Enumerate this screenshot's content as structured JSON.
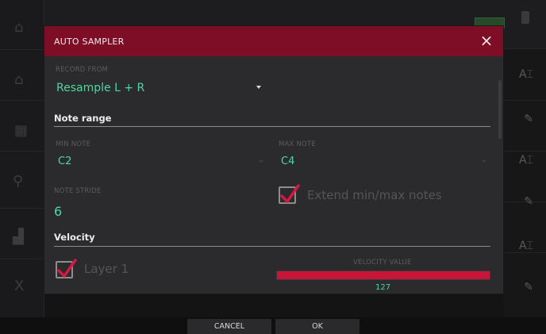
{
  "dialog": {
    "title": "AUTO SAMPLER",
    "record_from": {
      "label": "RECORD FROM",
      "value": "Resample L + R"
    },
    "note_range": {
      "heading": "Note range",
      "min_note": {
        "label": "MIN NOTE",
        "value": "C2"
      },
      "max_note": {
        "label": "MAX NOTE",
        "value": "C4"
      },
      "note_stride": {
        "label": "NOTE STRIDE",
        "value": "6"
      },
      "extend": {
        "label": "Extend min/max notes",
        "checked": true
      }
    },
    "velocity": {
      "heading": "Velocity",
      "layer1": {
        "label": "Layer 1",
        "checked": true
      },
      "value_label": "VELOCITY VALUE",
      "value": "127",
      "max": 127
    }
  },
  "buttons": {
    "cancel": "CANCEL",
    "ok": "OK"
  },
  "colors": {
    "accent": "#7e0e25",
    "value_text": "#4fd6a3",
    "check": "#d41a43",
    "velocity_bar": "#c8163b"
  }
}
